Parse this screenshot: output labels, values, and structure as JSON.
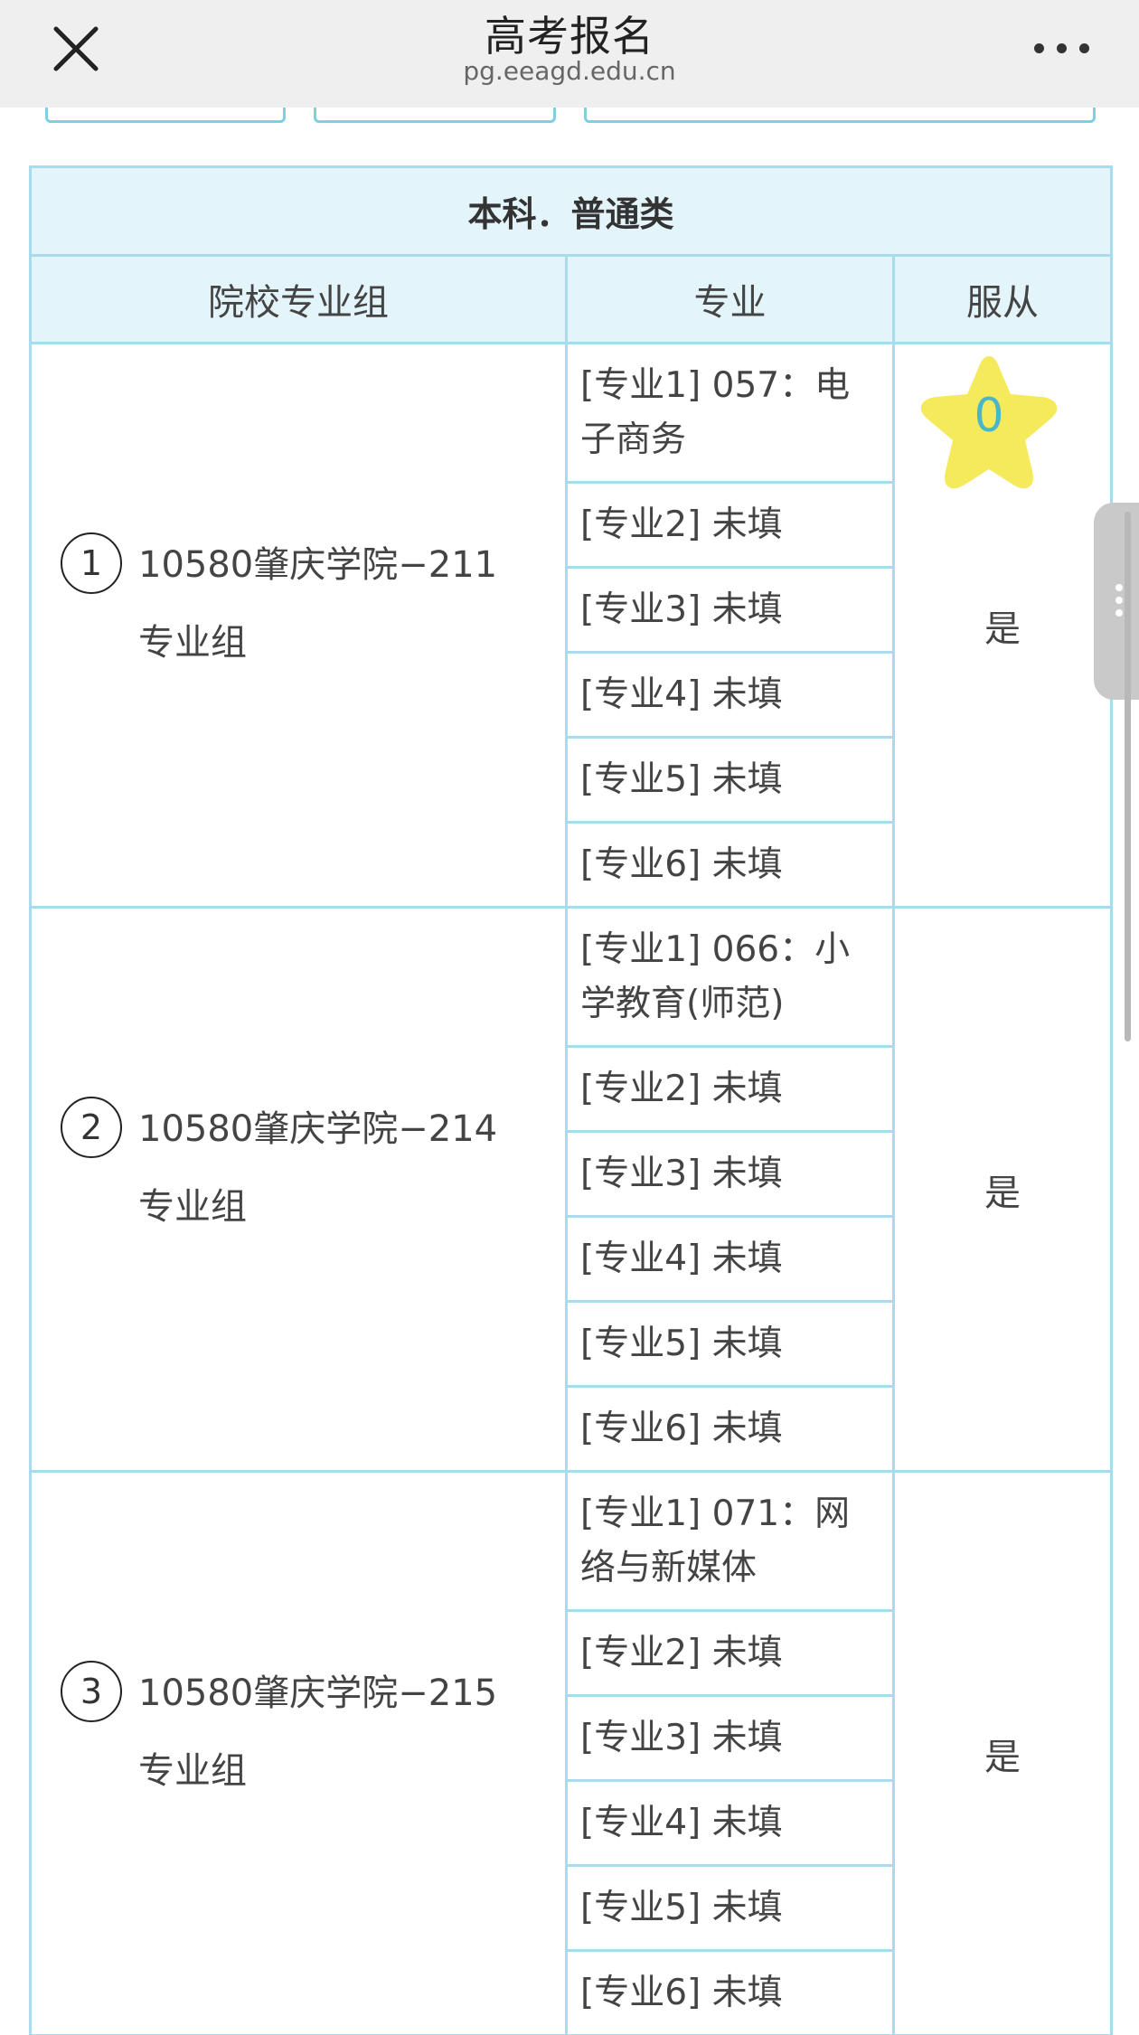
{
  "header": {
    "title": "高考报名",
    "url": "pg.eeagd.edu.cn"
  },
  "section": {
    "title": "本科．普通类"
  },
  "columns": {
    "group": "院校专业组",
    "major": "专业",
    "accept": "服从"
  },
  "star_badge": {
    "count": "0",
    "color": "#f5ea5c"
  },
  "groups": [
    {
      "num": "1",
      "name": "10580肇庆学院−211专业组",
      "accept": "是",
      "majors": [
        "[专业1] 057：电子商务",
        "[专业2] 未填",
        "[专业3] 未填",
        "[专业4] 未填",
        "[专业5] 未填",
        "[专业6] 未填"
      ]
    },
    {
      "num": "2",
      "name": "10580肇庆学院−214专业组",
      "accept": "是",
      "majors": [
        "[专业1] 066：小学教育(师范)",
        "[专业2] 未填",
        "[专业3] 未填",
        "[专业4] 未填",
        "[专业5] 未填",
        "[专业6] 未填"
      ]
    },
    {
      "num": "3",
      "name": "10580肇庆学院−215专业组",
      "accept": "是",
      "majors": [
        "[专业1] 071：网络与新媒体",
        "[专业2] 未填",
        "[专业3] 未填",
        "[专业4] 未填",
        "[专业5] 未填",
        "[专业6] 未填"
      ]
    }
  ],
  "colors": {
    "table_border": "#a8dcec",
    "header_bg": "#e4f4fb",
    "topbar_bg": "#efefef"
  }
}
